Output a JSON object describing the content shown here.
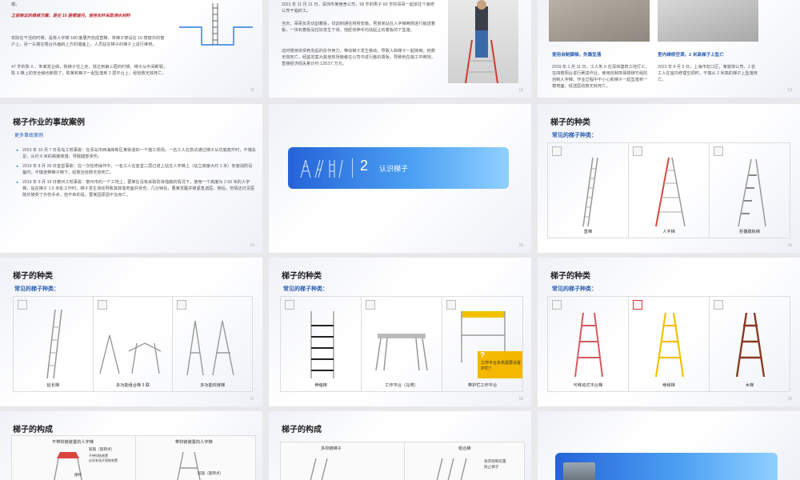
{
  "slides": {
    "s1": {
      "top_text": "楼。",
      "red_para": "之前商议的维修方案，是在 10 层楼道内，使用长杆采取浇水材料",
      "para1": "实际在干活的时候，是将人字梯 180 度展开完成直梯，将梯子架设在 10 楼窗外的窗户上，另一头搭在楼台外面斜上方的墙面上，人员站在梯子的梯子上进行维修。",
      "para2": "47 岁的陈 X 、朱某发业绩，我梯子往上走，抵达到第三层的时候，梯子从中间断裂，陈 X 推上的安全绳也断裂了，陈某和梯子一起坠落到 2 层平台上，经抢救无效死亡。",
      "pnum": "11"
    },
    "s2": {
      "para1": "2021 年 11 月 21 日，深圳市某宿舍公司，58 岁的男子 60 岁的哥哥一起前往个装修公司干临时工。",
      "para2": "当天，哥哥负责切割着板，切割到通往将将安装。男弟弟站在人字梯两侧进行输送着板，一块石着板没拉好发生下滑，他赶快伸手向扶起止石着板的下坠落。",
      "para3": "这时候身体受到向后的反作用力，带动梯子发生移动，导致人和梯子一起摔倒。他救无效死亡，经鉴定案为其他现场施者在公司中进行搬石膏板，导致他在施工中倒地，直接经济损失累计约 128.57 万元。",
      "pnum": "12"
    },
    "s3": {
      "cap1": "使用自制脚梯，失稳坠落",
      "cap2": "室内维修空调，2 米高梯子上坠亡",
      "text1": "2019 年 1 月 11 日，工人朱 X 在深圳建筑工地打工，在四楼阳台进行刷漆作业，使用自制简易楼梯竹组的自制人字梯，作业过程中不小心和梯子一起坠落到一楼地面，经送医抢救无效死亡。",
      "text2": "2023 年 8 月 5 日，上海市虹口区，某装饰公司，1 名工人在室内修理空调时，不慎从 2 米高的梯子上坠落死亡。",
      "pnum": "13"
    },
    "s4": {
      "title": "梯子作业的事故案例",
      "subtitle": "更多事故案例",
      "cases": [
        "2023 年 10 月 7 日青岛工地事故：在青岛市西海岸新区某街道的一个施工现场，一名工人在尝试通过梯子从坑底爬升时，不慎失足，从约 6 米的高度摔落，导致腿部受伤。",
        "2019 年 8 月 26 日金堂事故：在一次检修操作中，一名工人在金堂二层过道上站在人字梯上（站立高度大约 1 米）安装消防设备时，不慎连带梯子倒下，经救治抢救无效死亡。",
        "2019 年 6 月 19 日泰州工地事故：泰州市的一个工地上，曹某在没有采取防滑措施的情况下，使用一个高度为 2.93 米的人字梯，站在梯子 1.5 米处工作时，梯子发生滑动导致其摔落地面并受伤，几分钟后，曹某苏醒并被紧急送医，随后，伤情还日见医院并接受了外伤手术，但不幸的是，曹某因原因不治身亡。"
      ],
      "pnum": "14"
    },
    "s5": {
      "num": "2",
      "label": "认识梯子",
      "pnum": "15"
    },
    "s6": {
      "title": "梯子的种类",
      "subtitle": "常见的梯子种类：",
      "items": [
        "直梯",
        "人字梯",
        "折叠踏板梯"
      ],
      "pnum": "16"
    },
    "s7": {
      "title": "梯子的种类",
      "subtitle": "常见的梯子种类：",
      "items": [
        "延长梯",
        "多功能组合梯 3 联",
        "多功能铰链梯"
      ],
      "pnum": "17"
    },
    "s8": {
      "title": "梯子的种类",
      "subtitle": "常见的梯子种类：",
      "items": [
        "伸缩梯",
        "工作平台（马凳）",
        "带护栏工作平台"
      ],
      "callout": "工作平台多高需要设置护栏？",
      "callout_q": "?",
      "pnum": "18"
    },
    "s9": {
      "title": "梯子的种类",
      "subtitle": "常见的梯子种类：",
      "items": [
        "可移动式平台梯",
        "绝缘梯",
        "木梯"
      ],
      "pnum": "19"
    },
    "s10": {
      "title": "梯子的构成",
      "head1": "不带铰链装置的人字梯",
      "head2": "带铰链装置的人字梯",
      "lab1": "铰链（旋转点）",
      "lab2": "不带铰链装置\n必须有张开限制装置",
      "lab3": "撑杆",
      "lab4": "铰链（旋转点）"
    },
    "s11": {
      "title": "梯子的构成",
      "head1": "多铰链梯子",
      "head2": "组合梯",
      "lab1": "张开限制装置\n防止梯子"
    }
  },
  "colors": {
    "accent": "#2a5db0",
    "red": "#c0262d",
    "banner_start": "#2563d8",
    "banner_end": "#8fd0ff",
    "callout": "#f5b800"
  }
}
